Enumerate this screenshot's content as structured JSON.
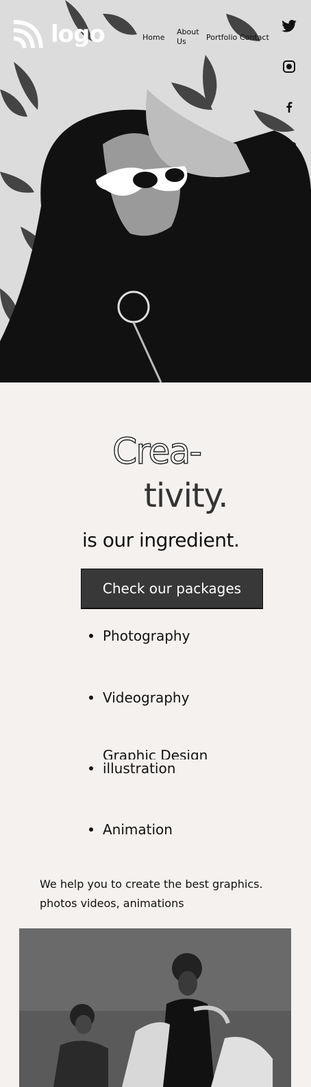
{
  "header": {
    "logo_text": "logo",
    "nav": {
      "home": "Home",
      "about": "About Us",
      "portfolio": "Portfolio",
      "contact": "Contact"
    },
    "social_icons": [
      "twitter-icon",
      "instagram-icon",
      "facebook-icon",
      "mail-icon"
    ]
  },
  "hero": {
    "headline_outline": "Crea-",
    "headline_solid": "tivity.",
    "tagline": "is our ingredient.",
    "cta_label": "Check our packages"
  },
  "services": {
    "items": [
      "Photography",
      "Videography",
      "Graphic Design",
      "illustration",
      "Animation"
    ]
  },
  "about": {
    "description": "We help you to create the best graphics. photos videos, animations"
  },
  "colors": {
    "background": "#f4f1ee",
    "button_bg": "#383838",
    "text": "#111111"
  }
}
